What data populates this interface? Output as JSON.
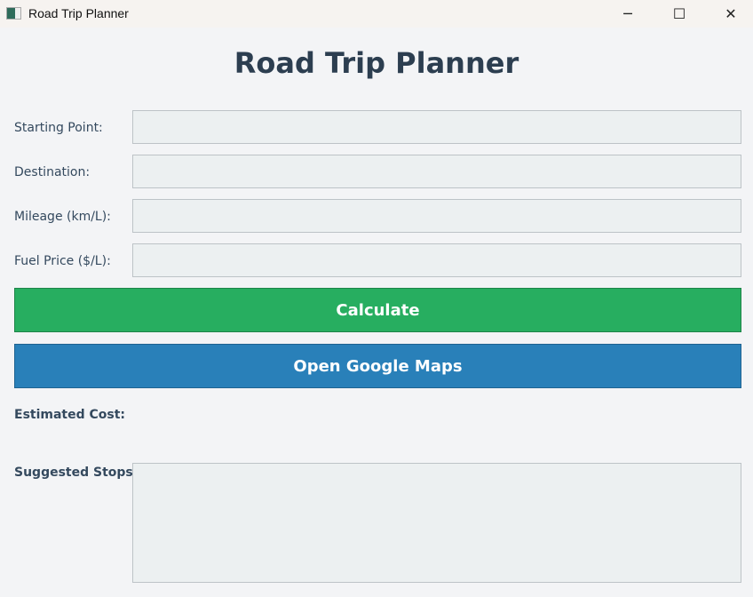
{
  "window": {
    "title": "Road Trip Planner",
    "min_icon": "minimize-icon",
    "max_icon": "maximize-icon",
    "close_icon": "close-icon"
  },
  "heading": "Road Trip Planner",
  "fields": [
    {
      "label": "Starting Point:",
      "value": ""
    },
    {
      "label": "Destination:",
      "value": ""
    },
    {
      "label": "Mileage (km/L):",
      "value": ""
    },
    {
      "label": "Fuel Price ($/L):",
      "value": ""
    }
  ],
  "buttons": {
    "calculate": "Calculate",
    "maps": "Open Google Maps"
  },
  "results": {
    "cost_label": "Estimated Cost:",
    "cost_value": "",
    "stops_label": "Suggested Stops:",
    "stops_value": ""
  },
  "colors": {
    "green": "#27ae60",
    "blue": "#2980b9"
  }
}
